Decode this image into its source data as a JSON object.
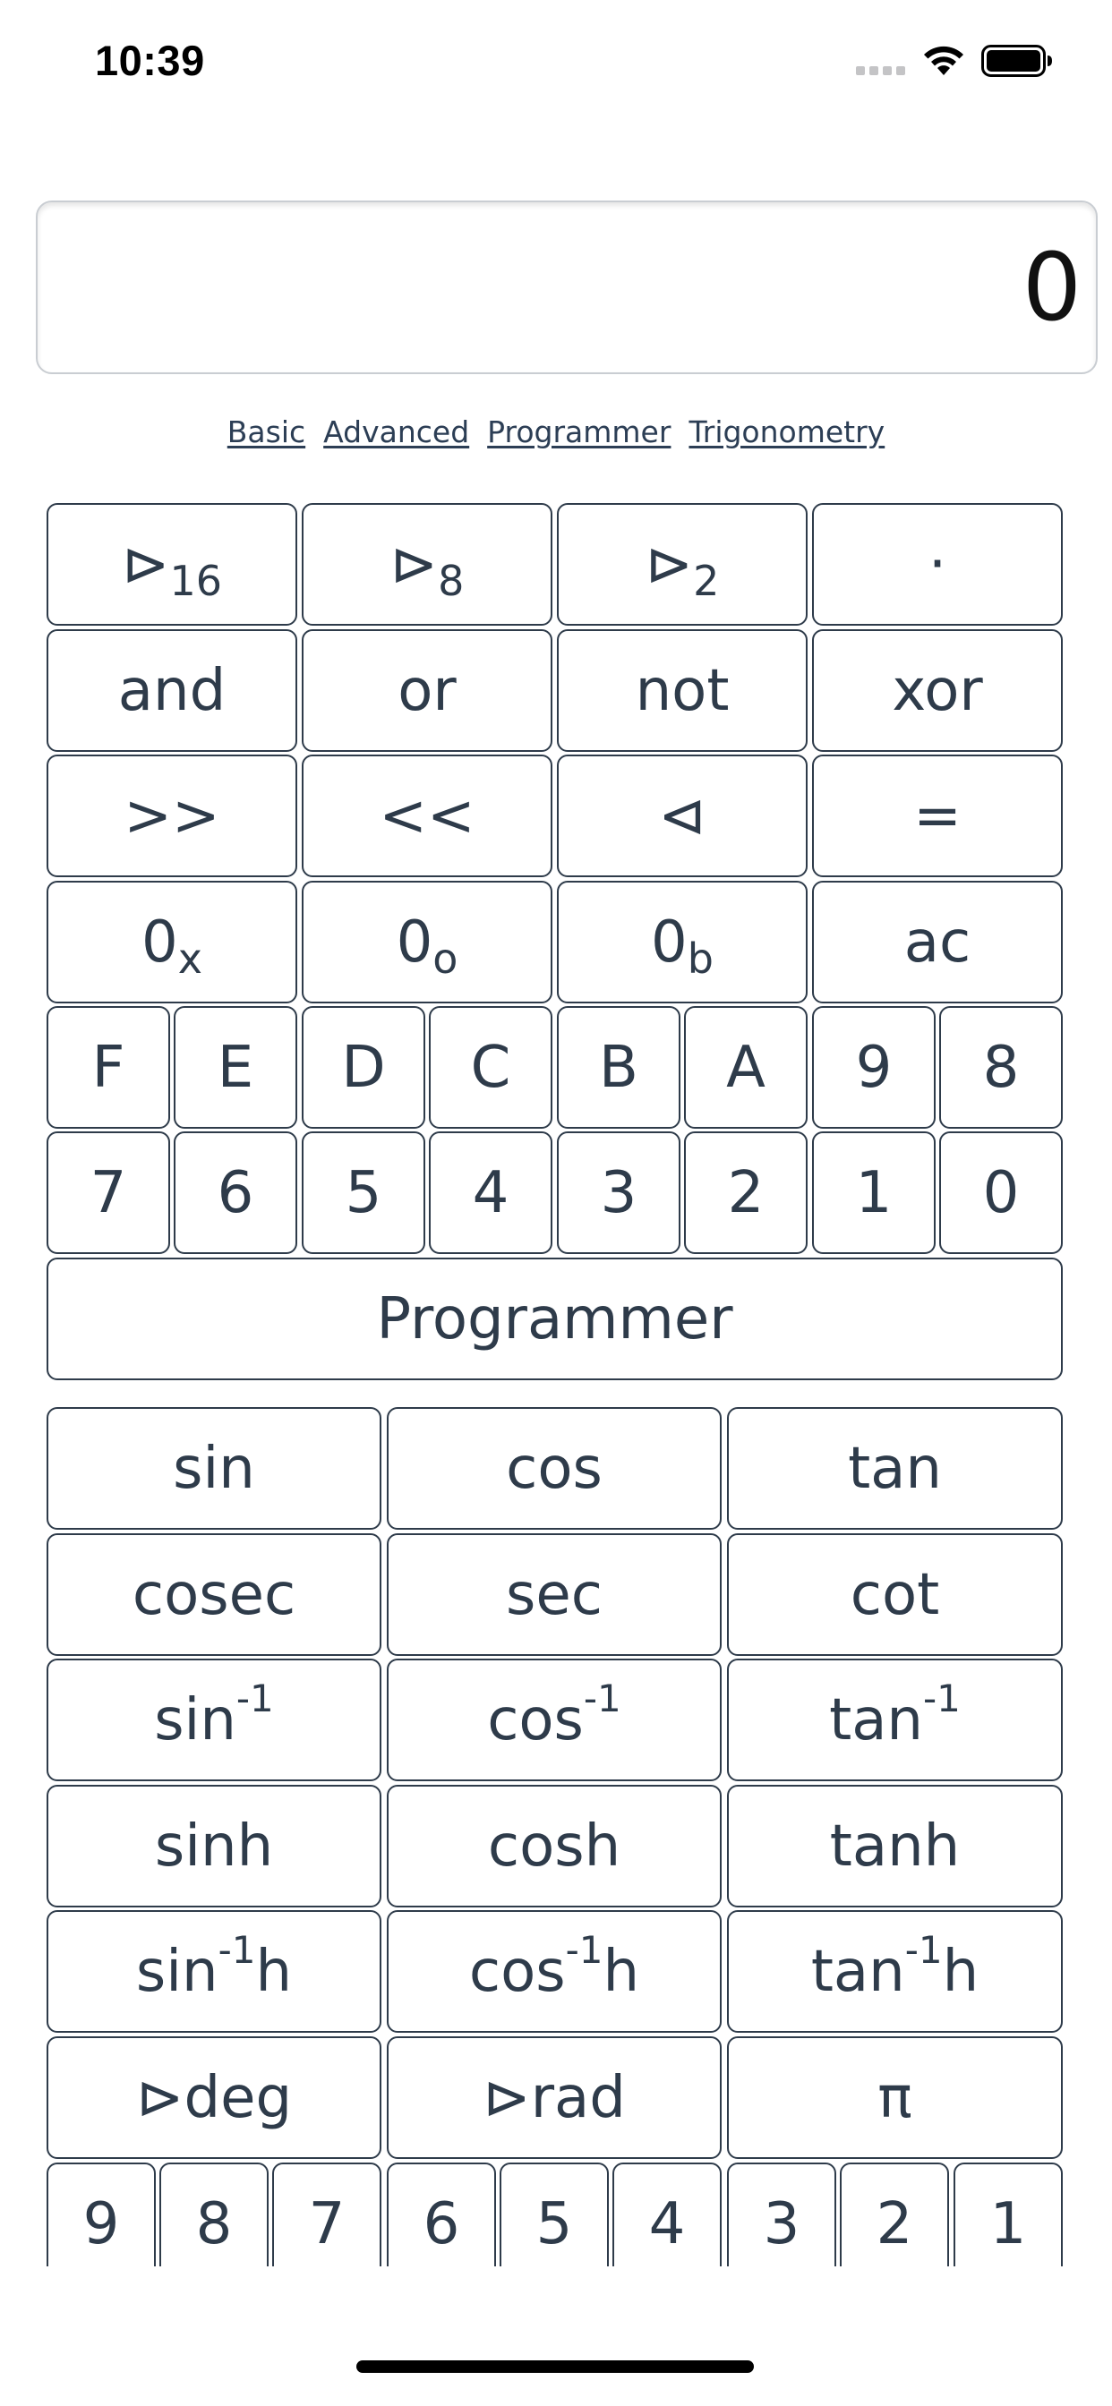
{
  "status_bar": {
    "time": "10:39",
    "icons": [
      "signal-icon",
      "wifi-icon",
      "battery-icon"
    ]
  },
  "display": {
    "value": "0"
  },
  "modes": {
    "items": [
      "Basic",
      "Advanced",
      "Programmer",
      "Trigonometry"
    ]
  },
  "programmer": {
    "row1": [
      {
        "main": "⊳",
        "sub": "16"
      },
      {
        "main": "⊳",
        "sub": "8"
      },
      {
        "main": "⊳",
        "sub": "2"
      },
      {
        "main": "·",
        "sub": ""
      }
    ],
    "row2": [
      "and",
      "or",
      "not",
      "xor"
    ],
    "row3": [
      ">>",
      "<<",
      "⊲",
      "="
    ],
    "row4": [
      {
        "main": "0",
        "sub": "x"
      },
      {
        "main": "0",
        "sub": "o"
      },
      {
        "main": "0",
        "sub": "b"
      },
      {
        "main": "ac",
        "sub": ""
      }
    ],
    "hex_row": [
      "F",
      "E",
      "D",
      "C",
      "B",
      "A",
      "9",
      "8"
    ],
    "digit_row": [
      "7",
      "6",
      "5",
      "4",
      "3",
      "2",
      "1",
      "0"
    ],
    "mode_button": "Programmer"
  },
  "trigonometry": {
    "row1": [
      "sin",
      "cos",
      "tan"
    ],
    "row2": [
      "cosec",
      "sec",
      "cot"
    ],
    "row3": [
      {
        "main": "sin",
        "sup": "-1",
        "tail": ""
      },
      {
        "main": "cos",
        "sup": "-1",
        "tail": ""
      },
      {
        "main": "tan",
        "sup": "-1",
        "tail": ""
      }
    ],
    "row4": [
      "sinh",
      "cosh",
      "tanh"
    ],
    "row5": [
      {
        "main": "sin",
        "sup": "-1",
        "tail": "h"
      },
      {
        "main": "cos",
        "sup": "-1",
        "tail": "h"
      },
      {
        "main": "tan",
        "sup": "-1",
        "tail": "h"
      }
    ],
    "row6": [
      "⊳deg",
      "⊳rad",
      "π"
    ],
    "digits": [
      "9",
      "8",
      "7",
      "6",
      "5",
      "4",
      "3",
      "2",
      "1"
    ]
  }
}
